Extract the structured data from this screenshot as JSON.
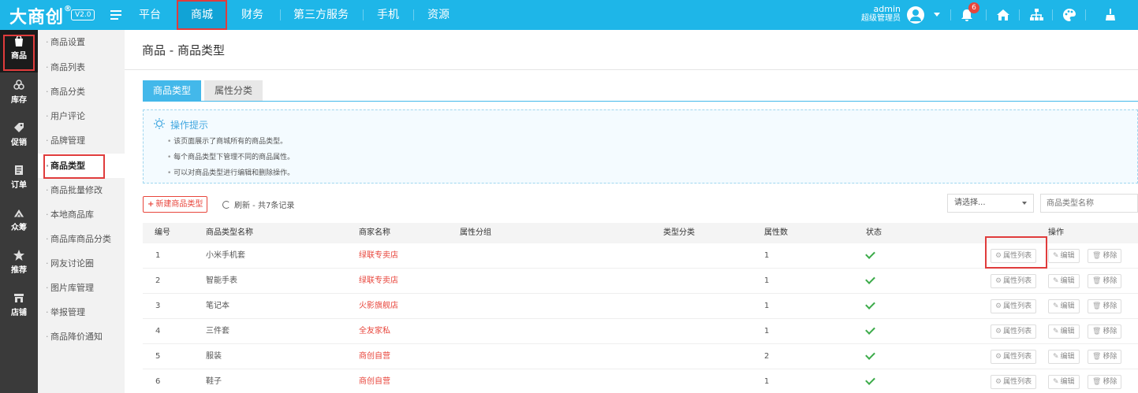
{
  "topbar": {
    "logo": "大商创",
    "logo_mark": "®",
    "version": "V2.0",
    "nav": [
      "平台",
      "商城",
      "财务",
      "第三方服务",
      "手机",
      "资源"
    ],
    "active_nav": "商城",
    "user_name": "admin",
    "user_role": "超级管理员",
    "notification_count": "6",
    "accent_color": "#1eb6e8"
  },
  "iconbar": [
    {
      "label": "商品",
      "icon": "shopping-bag-icon",
      "active": true
    },
    {
      "label": "库存",
      "icon": "stock-icon"
    },
    {
      "label": "促销",
      "icon": "promotion-icon"
    },
    {
      "label": "订单",
      "icon": "order-icon"
    },
    {
      "label": "众筹",
      "icon": "crowdfunding-icon"
    },
    {
      "label": "推荐",
      "icon": "star-icon"
    },
    {
      "label": "店铺",
      "icon": "store-icon"
    }
  ],
  "subbar": [
    "商品设置",
    "商品列表",
    "商品分类",
    "用户评论",
    "品牌管理",
    "商品类型",
    "商品批量修改",
    "本地商品库",
    "商品库商品分类",
    "网友讨论圈",
    "图片库管理",
    "举报管理",
    "商品降价通知"
  ],
  "subbar_active": "商品类型",
  "page": {
    "title": "商品 - 商品类型",
    "tabs": [
      "商品类型",
      "属性分类"
    ],
    "tips_title": "操作提示",
    "tips": [
      "该页面展示了商城所有的商品类型。",
      "每个商品类型下管理不同的商品属性。",
      "可以对商品类型进行编辑和删除操作。"
    ],
    "add_button": "新建商品类型",
    "refresh_text": "刷新 - 共7条记录",
    "select_placeholder": "请选择...",
    "search_placeholder": "商品类型名称"
  },
  "table": {
    "headers": [
      "编号",
      "商品类型名称",
      "商家名称",
      "属性分组",
      "类型分类",
      "属性数",
      "状态",
      "操作"
    ],
    "actions": [
      "属性列表",
      "编辑",
      "移除"
    ],
    "rows": [
      {
        "id": "1",
        "name": "小米手机套",
        "shop": "绿联专卖店",
        "group": "",
        "category": "",
        "count": "1"
      },
      {
        "id": "2",
        "name": "智能手表",
        "shop": "绿联专卖店",
        "group": "",
        "category": "",
        "count": "1"
      },
      {
        "id": "3",
        "name": "笔记本",
        "shop": "火影旗舰店",
        "group": "",
        "category": "",
        "count": "1"
      },
      {
        "id": "4",
        "name": "三件套",
        "shop": "全友家私",
        "group": "",
        "category": "",
        "count": "1"
      },
      {
        "id": "5",
        "name": "服装",
        "shop": "商创自营",
        "group": "",
        "category": "",
        "count": "2"
      },
      {
        "id": "6",
        "name": "鞋子",
        "shop": "商创自营",
        "group": "",
        "category": "",
        "count": "1"
      }
    ]
  }
}
